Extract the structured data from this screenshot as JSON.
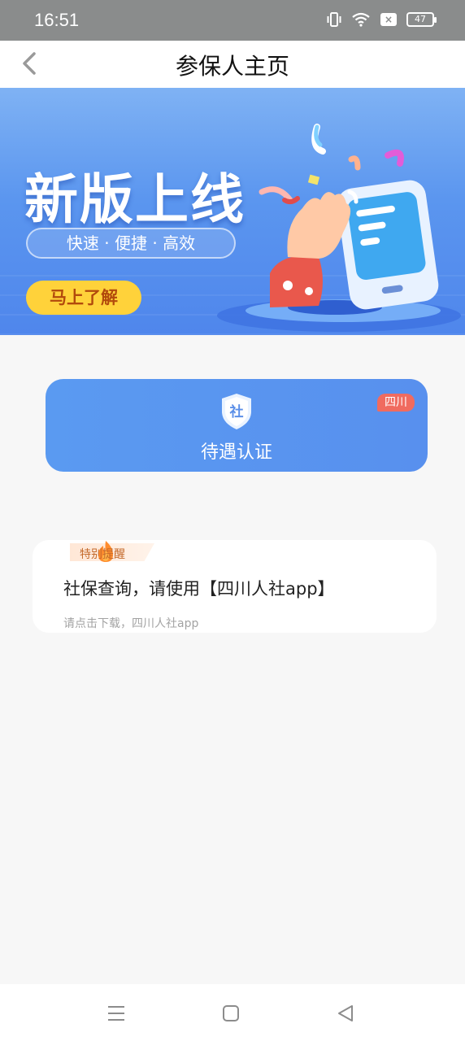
{
  "status_bar": {
    "time": "16:51",
    "battery": "47",
    "icons": [
      "vibrate-icon",
      "wifi-icon",
      "sim-x-icon",
      "battery-icon"
    ]
  },
  "header": {
    "title": "参保人主页"
  },
  "banner": {
    "title": "新版上线",
    "tagline": "快速 · 便捷 · 高效",
    "cta": "马上了解"
  },
  "auth_card": {
    "label": "待遇认证",
    "shield_char": "社",
    "region": "四川"
  },
  "notice": {
    "tag": "特别提醒",
    "title": "社保查询，请使用【四川人社app】",
    "subtitle": "请点击下载，四川人社app"
  },
  "colors": {
    "accent": "#5890ee",
    "banner_cta": "#ffd23a",
    "badge": "#f06b5f",
    "background": "#f7f7f7"
  }
}
